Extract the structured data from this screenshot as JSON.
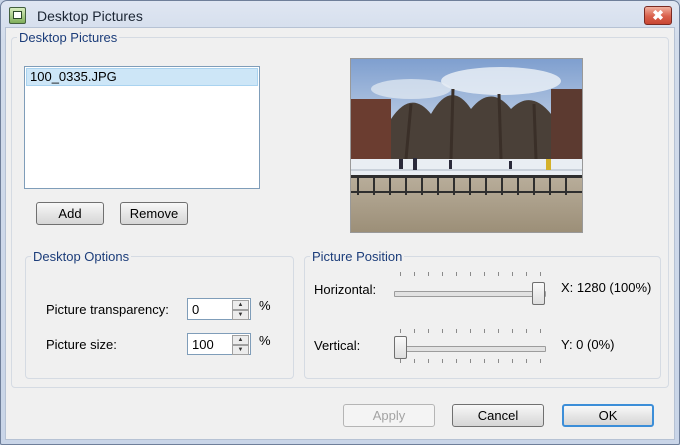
{
  "window": {
    "title": "Desktop Pictures",
    "close_glyph": "✖"
  },
  "desktop_pictures": {
    "group_label": "Desktop Pictures",
    "files": [
      "100_0335.JPG"
    ],
    "selected_file": "100_0335.JPG",
    "add_label": "Add",
    "remove_label": "Remove"
  },
  "desktop_options": {
    "group_label": "Desktop Options",
    "transparency_label": "Picture transparency:",
    "transparency_value": "0",
    "transparency_unit": "%",
    "size_label": "Picture size:",
    "size_value": "100",
    "size_unit": "%"
  },
  "picture_position": {
    "group_label": "Picture Position",
    "horizontal_label": "Horizontal:",
    "horizontal_readout": "X: 1280 (100%)",
    "horizontal_fraction": 1.0,
    "vertical_label": "Vertical:",
    "vertical_readout": "Y: 0 (0%)",
    "vertical_fraction": 0.0
  },
  "buttons": {
    "apply": "Apply",
    "cancel": "Cancel",
    "ok": "OK"
  },
  "icons": {
    "spin_up": "up-arrow-icon",
    "spin_down": "down-arrow-icon",
    "app": "desktop-pictures-icon"
  }
}
